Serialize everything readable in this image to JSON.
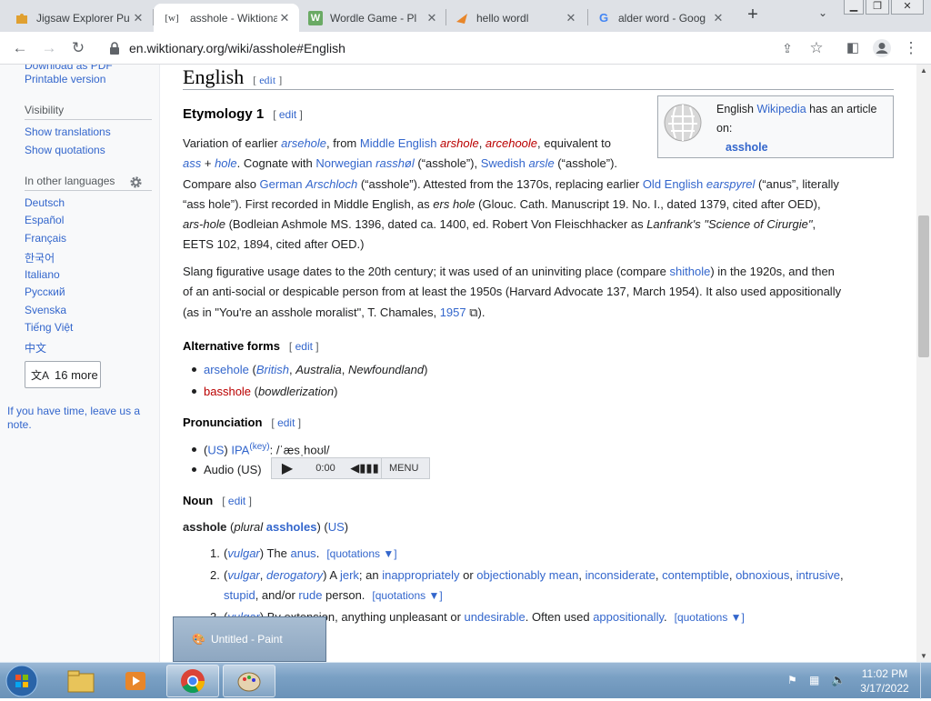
{
  "browser": {
    "tabs": [
      {
        "title": "Jigsaw Explorer Pu",
        "icon": "puzzle-icon"
      },
      {
        "title": "asshole - Wiktionar",
        "icon": "wiktionary-icon",
        "active": true
      },
      {
        "title": "Wordle Game - Pl",
        "icon": "wordle-icon"
      },
      {
        "title": "hello wordl",
        "icon": "hello-wordl-icon"
      },
      {
        "title": "alder word - Goog",
        "icon": "google-icon"
      }
    ],
    "url": "en.wiktionary.org/wiki/asshole#English"
  },
  "sidebar": {
    "top_partial": "Download as PDF",
    "printable": "Printable version",
    "visibility_head": "Visibility",
    "show_translations": "Show translations",
    "show_quotations": "Show quotations",
    "languages_head": "In other languages",
    "languages": [
      "Deutsch",
      "Español",
      "Français",
      "한국어",
      "Italiano",
      "Русский",
      "Svenska",
      "Tiếng Việt",
      "中文"
    ],
    "more_label": "16 more",
    "feedback": "If you have time, leave us a note."
  },
  "article": {
    "h2": "English",
    "edit": "edit",
    "etymology_head": "Etymology 1",
    "wp_box": {
      "pre": "English ",
      "link": "Wikipedia",
      "post": " has an article on:",
      "article": "asshole"
    },
    "etym_lines": [
      [
        [
          "Variation of earlier ",
          ""
        ],
        [
          "arsehole",
          "li"
        ],
        [
          ", from ",
          ""
        ],
        [
          "Middle English",
          "l"
        ],
        [
          " ",
          ""
        ],
        [
          "arshole",
          "ri"
        ],
        [
          ", ",
          ""
        ],
        [
          "arcehoole",
          "ri"
        ],
        [
          ", equivalent to",
          ""
        ]
      ],
      [
        [
          "ass",
          "li"
        ],
        [
          " + ",
          ""
        ],
        [
          "hole",
          "li"
        ],
        [
          ". Cognate with ",
          ""
        ],
        [
          "Norwegian",
          "l"
        ],
        [
          " ",
          ""
        ],
        [
          "rasshøl",
          "li"
        ],
        [
          " (“asshole”), ",
          ""
        ],
        [
          "Swedish",
          "l"
        ],
        [
          " ",
          ""
        ],
        [
          "arsle",
          "li"
        ],
        [
          " (“asshole”).",
          ""
        ]
      ],
      [
        [
          "Compare also ",
          ""
        ],
        [
          "German",
          "l"
        ],
        [
          " ",
          ""
        ],
        [
          "Arschloch",
          "li"
        ],
        [
          " (“asshole”). Attested from the 1370s, replacing earlier ",
          ""
        ],
        [
          "Old English",
          "l"
        ],
        [
          " ",
          ""
        ],
        [
          "earspyrel",
          "li"
        ],
        [
          " (“anus”, literally",
          ""
        ]
      ],
      [
        [
          "“ass hole”). First recorded in Middle English, as ",
          ""
        ],
        [
          "ers hole",
          "i"
        ],
        [
          " (Glouc. Cath. Manuscript 19. No. I., dated 1379, cited after OED),",
          ""
        ]
      ],
      [
        [
          "ars-hole",
          "i"
        ],
        [
          " (Bodleian Ashmole MS. 1396, dated ca. 1400, ed. Robert Von Fleischhacker as ",
          ""
        ],
        [
          "Lanfrank's \"Science of Cirurgie\"",
          "i"
        ],
        [
          ",",
          ""
        ]
      ],
      [
        [
          "EETS 102, 1894, cited after OED.)",
          ""
        ]
      ]
    ],
    "slang_lines": [
      [
        [
          "Slang figurative usage dates to the 20th century; it was used of an uninviting place (compare ",
          ""
        ],
        [
          "shithole",
          "l"
        ],
        [
          ") in the 1920s, and then",
          ""
        ]
      ],
      [
        [
          "of an anti-social or despicable person from at least the 1950s (Harvard Advocate 137, March 1954). It also used appositionally",
          ""
        ]
      ],
      [
        [
          "(as in \"You're an asshole moralist\", T. Chamales, ",
          ""
        ],
        [
          "1957",
          "l"
        ],
        [
          " ⧉).",
          ""
        ]
      ]
    ],
    "alt_head": "Alternative forms",
    "alt_items": [
      [
        [
          "arsehole",
          "l"
        ],
        [
          " (",
          ""
        ],
        [
          "British",
          "li"
        ],
        [
          ", ",
          ""
        ],
        [
          "Australia",
          "i"
        ],
        [
          ", ",
          ""
        ],
        [
          "Newfoundland",
          "i"
        ],
        [
          ")",
          ""
        ]
      ],
      [
        [
          "basshole",
          "r"
        ],
        [
          " (",
          ""
        ],
        [
          "bowdlerization",
          "i"
        ],
        [
          ")",
          ""
        ]
      ]
    ],
    "pron_head": "Pronunciation",
    "pron_ipa": [
      [
        "(",
        ""
      ],
      [
        "US",
        "l"
      ],
      [
        ") ",
        ""
      ],
      [
        "IPA",
        "l"
      ],
      [
        "(key)",
        "ls"
      ],
      [
        ": /ˈæsˌhoʊl/",
        ""
      ]
    ],
    "audio_label": "Audio (US)",
    "audio_time": "0:00",
    "audio_menu": "MENU",
    "noun_head": "Noun",
    "headword": [
      [
        "asshole",
        "b"
      ],
      [
        " (",
        ""
      ],
      [
        "plural",
        "i"
      ],
      [
        " ",
        ""
      ],
      [
        "assholes",
        "lb"
      ],
      [
        ") (",
        ""
      ],
      [
        "US",
        "l"
      ],
      [
        ")",
        ""
      ]
    ],
    "quotations_label": "quotations ▼",
    "senses": [
      {
        "num": "1.",
        "lines": [
          [
            [
              "(",
              ""
            ],
            [
              "vulgar",
              "li"
            ],
            [
              ") The ",
              ""
            ],
            [
              "anus",
              "l"
            ],
            [
              ".",
              ""
            ]
          ]
        ]
      },
      {
        "num": "2.",
        "lines": [
          [
            [
              "(",
              ""
            ],
            [
              "vulgar",
              "li"
            ],
            [
              ", ",
              ""
            ],
            [
              "derogatory",
              "li"
            ],
            [
              ") A ",
              ""
            ],
            [
              "jerk",
              "l"
            ],
            [
              "; an ",
              ""
            ],
            [
              "inappropriately",
              "l"
            ],
            [
              " or ",
              ""
            ],
            [
              "objectionably",
              "l"
            ],
            [
              " ",
              ""
            ],
            [
              "mean",
              "l"
            ],
            [
              ", ",
              ""
            ],
            [
              "inconsiderate",
              "l"
            ],
            [
              ", ",
              ""
            ],
            [
              "contemptible",
              "l"
            ],
            [
              ", ",
              ""
            ],
            [
              "obnoxious",
              "l"
            ],
            [
              ", ",
              ""
            ],
            [
              "intrusive",
              "l"
            ],
            [
              ",",
              ""
            ]
          ],
          [
            [
              "stupid",
              "l"
            ],
            [
              ", and/or ",
              ""
            ],
            [
              "rude",
              "l"
            ],
            [
              " person.",
              ""
            ]
          ]
        ]
      },
      {
        "num": "3.",
        "lines": [
          [
            [
              "(",
              ""
            ],
            [
              "vulgar",
              "li"
            ],
            [
              ") By extension, anything unpleasant or ",
              ""
            ],
            [
              "undesirable",
              "l"
            ],
            [
              ". Often used ",
              ""
            ],
            [
              "appositionally",
              "l"
            ],
            [
              ".",
              ""
            ]
          ]
        ]
      }
    ]
  },
  "taskbar": {
    "popup_title": "Untitled - Paint",
    "time": "11:02 PM",
    "date": "3/17/2022"
  },
  "colors": {
    "link": "#3366cc",
    "redlink": "#ba0000",
    "tabbar": "#dee1e6"
  }
}
